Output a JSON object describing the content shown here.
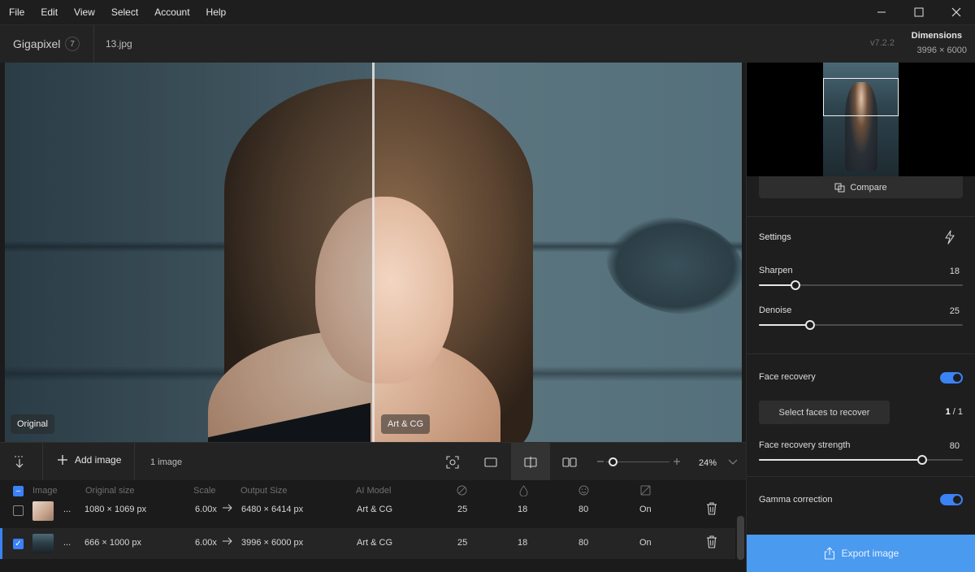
{
  "menu": [
    "File",
    "Edit",
    "View",
    "Select",
    "Account",
    "Help"
  ],
  "window_controls": {
    "minimize": "—",
    "maximize": "☐",
    "close": "✕"
  },
  "header": {
    "brand": "Gigapixel",
    "badge": "7",
    "file_name": "13.jpg",
    "version": "v7.2.2",
    "dimensions_label": "Dimensions",
    "dimensions_value": "3996 × 6000"
  },
  "viewer": {
    "left_label": "Original",
    "right_label": "Art & CG"
  },
  "toolbar": {
    "add_image_label": "Add image",
    "image_count": "1 image",
    "zoom_value": "24%",
    "zoom_level": 0.1
  },
  "table": {
    "headers": [
      "Image",
      "Original size",
      "Scale",
      "Output Size",
      "AI Model"
    ],
    "rows": [
      {
        "dots": "...",
        "original": "1080 × 1069 px",
        "scale": "6.00x",
        "output": "6480 × 6414 px",
        "model": "Art & CG",
        "v1": "25",
        "v2": "18",
        "v3": "80",
        "v4": "On",
        "checked": false
      },
      {
        "dots": "...",
        "original": "666 × 1000 px",
        "scale": "6.00x",
        "output": "3996 × 6000 px",
        "model": "Art & CG",
        "v1": "25",
        "v2": "18",
        "v3": "80",
        "v4": "On",
        "checked": true
      }
    ]
  },
  "panel": {
    "compare_label": "Compare",
    "settings_title": "Settings",
    "sharpen": {
      "label": "Sharpen",
      "value": "18",
      "level": 0.18
    },
    "denoise": {
      "label": "Denoise",
      "value": "25",
      "level": 0.25
    },
    "face_recovery_label": "Face recovery",
    "face_recovery_on": true,
    "select_faces_label": "Select faces to recover",
    "faces_selected": "1",
    "faces_total": "/ 1",
    "face_strength": {
      "label": "Face recovery strength",
      "value": "80",
      "level": 0.8
    },
    "gamma_label": "Gamma correction",
    "gamma_on": true,
    "export_label": "Export image"
  },
  "colors": {
    "accent": "#3b82f6",
    "export": "#4a9af0"
  }
}
